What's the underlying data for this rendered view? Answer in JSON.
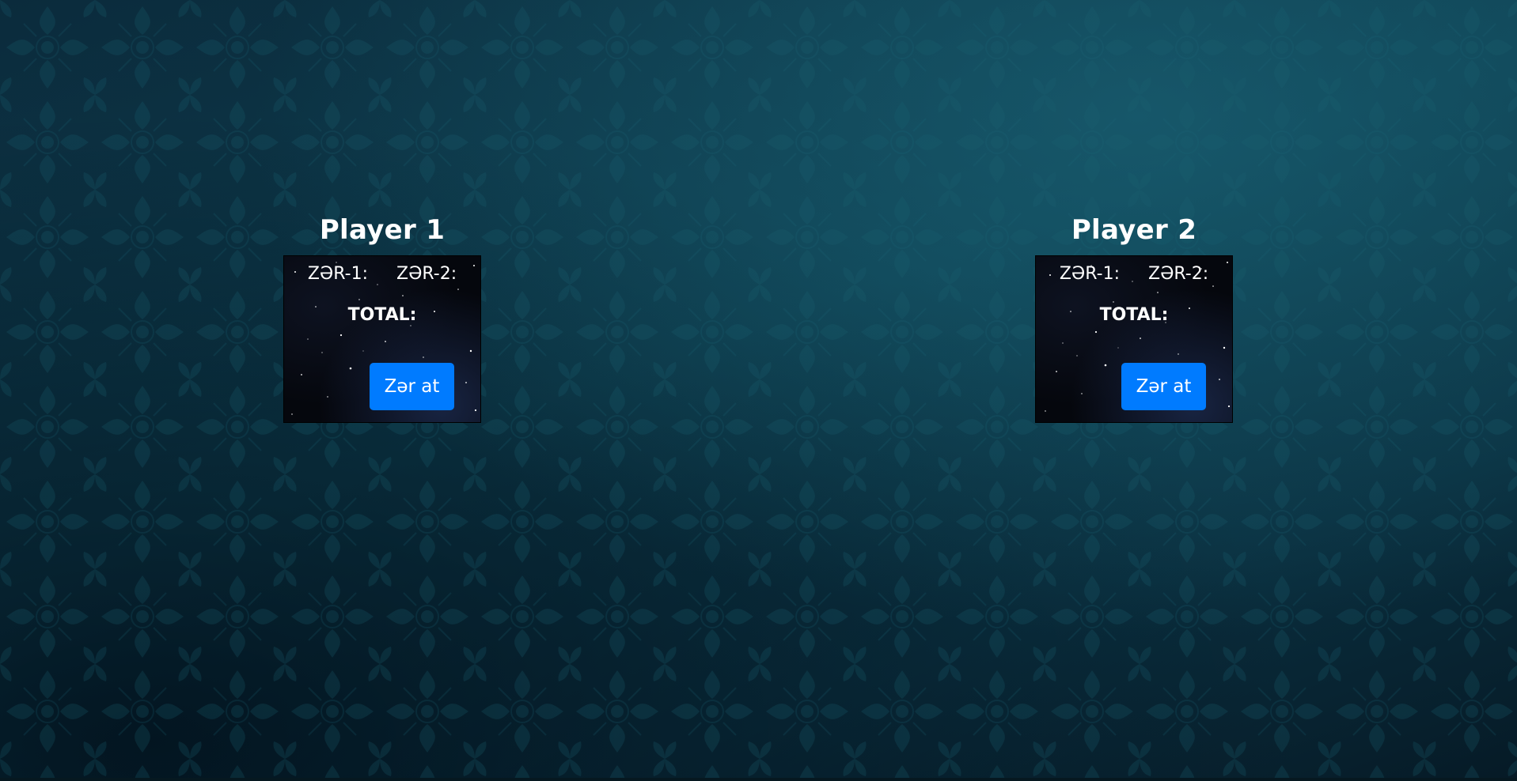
{
  "players": [
    {
      "title": "Player 1",
      "dice1_label": "ZƏR-1:",
      "dice2_label": "ZƏR-2:",
      "total_label": "TOTAL:",
      "roll_button": "Zər at"
    },
    {
      "title": "Player 2",
      "dice1_label": "ZƏR-1:",
      "dice2_label": "ZƏR-2:",
      "total_label": "TOTAL:",
      "roll_button": "Zər at"
    }
  ],
  "theme": {
    "background": "#0a3140",
    "button": "#007bff",
    "card": "#05070d"
  }
}
